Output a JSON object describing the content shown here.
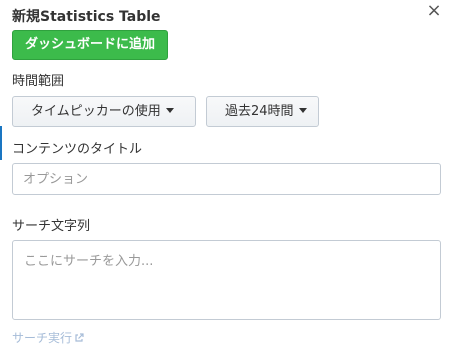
{
  "panel": {
    "title": "新規Statistics Table",
    "close_icon": "close-icon",
    "add_to_dashboard_label": "ダッシュボードに追加"
  },
  "time_range": {
    "label": "時間範囲",
    "picker_label": "タイムピッカーの使用",
    "preset_label": "過去24時間"
  },
  "content_title": {
    "label": "コンテンツのタイトル",
    "placeholder": "オプション",
    "value": ""
  },
  "search": {
    "label": "サーチ文字列",
    "placeholder": "ここにサーチを入力...",
    "value": "",
    "run_label": "サーチ実行",
    "run_icon": "external-link-icon"
  },
  "colors": {
    "accent_green": "#3cbb4b",
    "link_disabled": "#a6bcd8",
    "left_accent": "#1a76c2"
  }
}
